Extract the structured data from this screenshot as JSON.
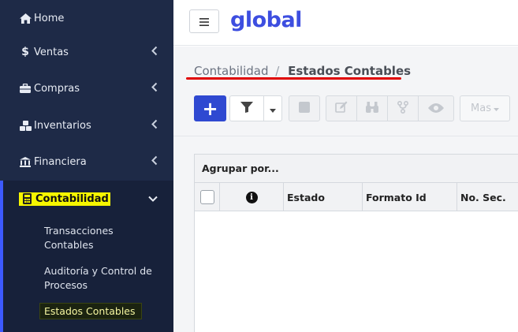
{
  "sidebar": {
    "items": [
      {
        "label": "Home",
        "icon": "home-icon"
      },
      {
        "label": "Ventas",
        "icon": "dollar-icon"
      },
      {
        "label": "Compras",
        "icon": "briefcase-icon"
      },
      {
        "label": "Inventarios",
        "icon": "cubes-icon"
      },
      {
        "label": "Financiera",
        "icon": "bank-icon"
      },
      {
        "label": "Contabilidad",
        "icon": "calculator-icon"
      }
    ],
    "sub_items": [
      {
        "label": "Transacciones Contables"
      },
      {
        "label": "Auditoría y Control de Procesos"
      },
      {
        "label": "Estados Contables"
      }
    ]
  },
  "header": {
    "logo_text": "global",
    "brand_color": "#3d4ee0"
  },
  "breadcrumb": {
    "parent": "Contabilidad",
    "separator": "/",
    "current": "Estados Contables"
  },
  "toolbar": {
    "add_label": "+",
    "more_label": "Mas"
  },
  "grid": {
    "group_by_label": "Agrupar por...",
    "columns": [
      "Estado",
      "Formato Id",
      "No. Sec."
    ]
  },
  "colors": {
    "sidebar_bg": "#1e2a47",
    "accent": "#2f49d1",
    "highlight": "#f6f600",
    "underline": "#e00000"
  }
}
